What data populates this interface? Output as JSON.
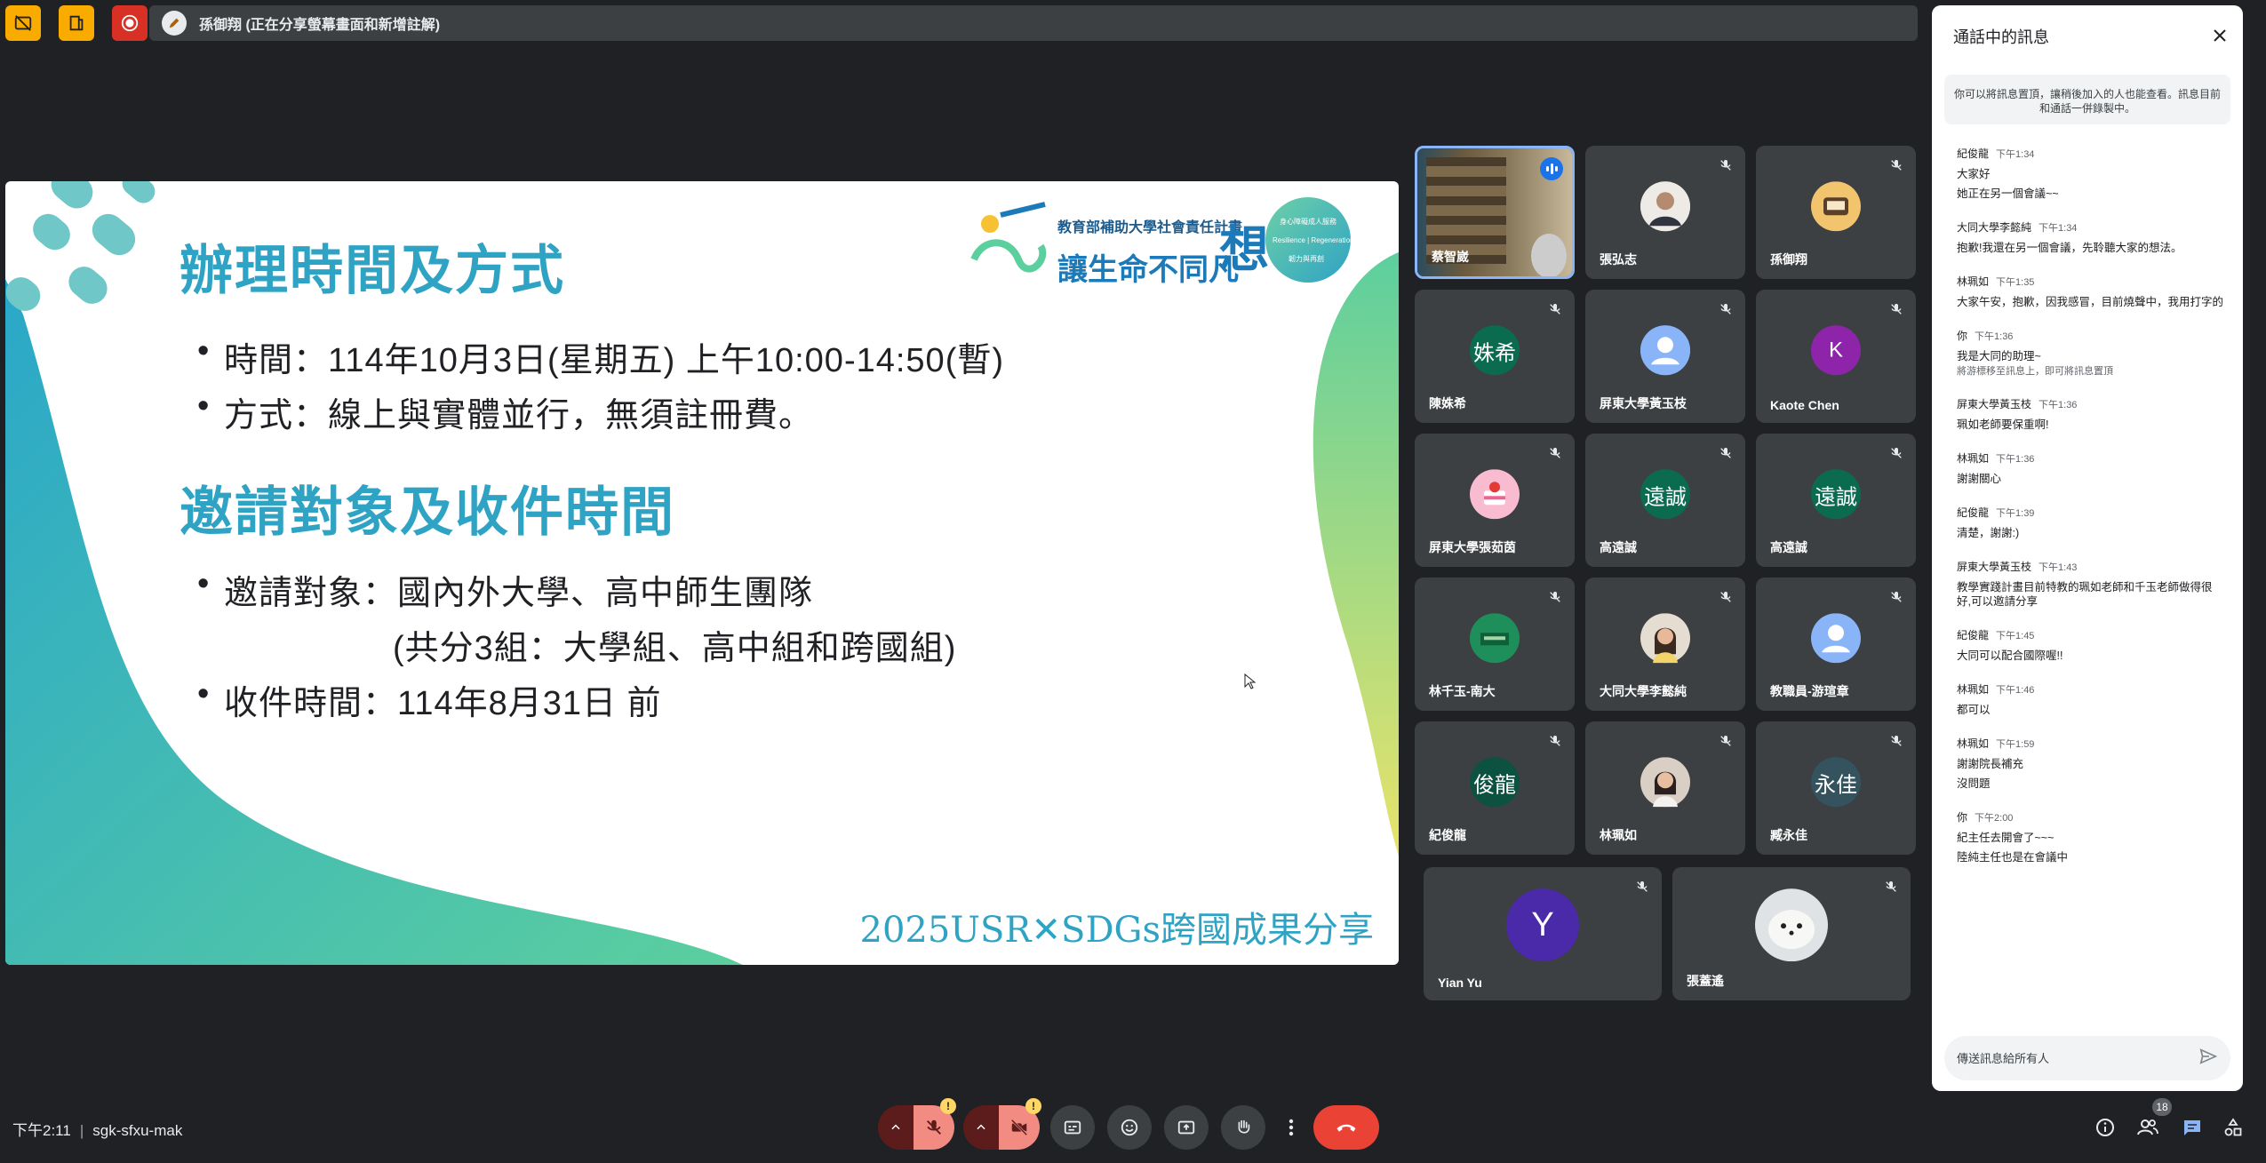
{
  "banner": {
    "text": "孫御翔 (正在分享螢幕畫面和新增註解)"
  },
  "slide": {
    "heading1": "辦理時間及方式",
    "bullets1": [
      "時間：114年10月3日(星期五) 上午10:00-14:50(暫)",
      "方式：線上與實體並行，無須註冊費。"
    ],
    "heading2": "邀請對象及收件時間",
    "bullets2": [
      "邀請對象：國內外大學、高中師生團隊",
      "(共分3組：大學組、高中組和跨國組)",
      "收件時間：114年8月31日 前"
    ],
    "footer": "2025USR✕SDGs跨國成果分享",
    "logo": {
      "line1": "教育部補助大學社會責任計畫",
      "line2": "讓生命不同凡",
      "big": "想",
      "badge_top": "身心障礙成人服務",
      "badge_mid": "Resilience | Regeneration",
      "badge_bottom": "韌力與再創"
    }
  },
  "participants": [
    {
      "name": "蔡智崴",
      "avatar_text": "",
      "avatar_color": "#6b5a3e",
      "speaking": true
    },
    {
      "name": "張弘志",
      "avatar_text": "",
      "avatar_color": "#d7d2cc"
    },
    {
      "name": "孫御翔",
      "avatar_text": "",
      "avatar_color": "#f2c46d"
    },
    {
      "name": "陳姝希",
      "avatar_text": "姝希",
      "avatar_color": "#0b6b4f"
    },
    {
      "name": "屏東大學黃玉枝",
      "avatar_text": "",
      "avatar_color": "#8ab4f8"
    },
    {
      "name": "Kaote Chen",
      "avatar_text": "K",
      "avatar_color": "#8e24aa"
    },
    {
      "name": "屏東大學張茹茵",
      "avatar_text": "",
      "avatar_color": "#f8bbd0"
    },
    {
      "name": "高遠誠",
      "avatar_text": "遠誠",
      "avatar_color": "#0b6b4f"
    },
    {
      "name": "高遠誠",
      "avatar_text": "遠誠",
      "avatar_color": "#0b6b4f"
    },
    {
      "name": "林千玉-南大",
      "avatar_text": "",
      "avatar_color": "#1e8e5a"
    },
    {
      "name": "大同大學李懿純",
      "avatar_text": "",
      "avatar_color": "#c9b8a6"
    },
    {
      "name": "教職員-游瑄章",
      "avatar_text": "",
      "avatar_color": "#8ab4f8"
    },
    {
      "name": "紀俊龍",
      "avatar_text": "俊龍",
      "avatar_color": "#0d5240"
    },
    {
      "name": "林珮如",
      "avatar_text": "",
      "avatar_color": "#b59a86"
    },
    {
      "name": "臧永佳",
      "avatar_text": "永佳",
      "avatar_color": "#34535e"
    },
    {
      "name": "Yian Yu",
      "avatar_text": "Y",
      "avatar_color": "#4a2aa8"
    },
    {
      "name": "張蓋遙",
      "avatar_text": "",
      "avatar_color": "#dfe3e6"
    }
  ],
  "chat": {
    "title": "通話中的訊息",
    "notice": "你可以將訊息置頂，讓稍後加入的人也能查看。訊息目前和通話一併錄製中。",
    "messages": [
      {
        "sender": "紀俊龍",
        "time": "下午1:34",
        "lines": [
          "大家好",
          "她正在另一個會議~~"
        ]
      },
      {
        "sender": "大同大學李懿純",
        "time": "下午1:34",
        "lines": [
          "抱歉!我還在另一個會議，先聆聽大家的想法。"
        ]
      },
      {
        "sender": "林珮如",
        "time": "下午1:35",
        "lines": [
          "大家午安，抱歉，因我感冒，目前燒聲中，我用打字的"
        ]
      },
      {
        "sender": "你",
        "time": "下午1:36",
        "lines": [
          "我是大同的助理~"
        ],
        "sub": "將游標移至訊息上，即可將訊息置頂"
      },
      {
        "sender": "屏東大學黃玉枝",
        "time": "下午1:36",
        "lines": [
          "珮如老師要保重啊!"
        ]
      },
      {
        "sender": "林珮如",
        "time": "下午1:36",
        "lines": [
          "謝謝關心"
        ]
      },
      {
        "sender": "紀俊龍",
        "time": "下午1:39",
        "lines": [
          "清楚，謝謝:)"
        ]
      },
      {
        "sender": "屏東大學黃玉枝",
        "time": "下午1:43",
        "lines": [
          "教學實踐計畫目前特教的珮如老師和千玉老師做得很好,可以邀請分享"
        ]
      },
      {
        "sender": "紀俊龍",
        "time": "下午1:45",
        "lines": [
          "大同可以配合國際喔!!"
        ]
      },
      {
        "sender": "林珮如",
        "time": "下午1:46",
        "lines": [
          "都可以"
        ]
      },
      {
        "sender": "林珮如",
        "time": "下午1:59",
        "lines": [
          "謝謝院長補充",
          "沒問題"
        ]
      },
      {
        "sender": "你",
        "time": "下午2:00",
        "lines": [
          "紀主任去開會了~~~",
          "陸純主任也是在會議中"
        ]
      }
    ],
    "input_placeholder": "傳送訊息給所有人"
  },
  "footer": {
    "time": "下午2:11",
    "meeting_code": "sgk-sfxu-mak",
    "participant_count": "18"
  },
  "colors": {
    "accent": "#2fa3c4",
    "end_call": "#ea4335",
    "muted": "#f28b82"
  }
}
